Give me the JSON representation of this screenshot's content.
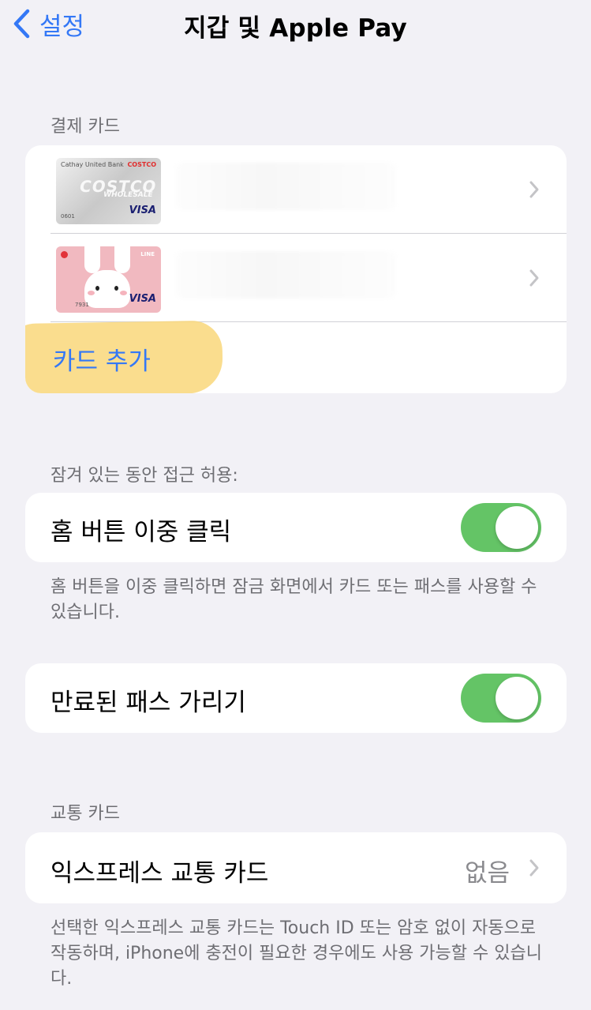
{
  "nav": {
    "back_label": "설정",
    "title": "지갑 및 Apple Pay"
  },
  "payment_cards": {
    "header": "결제 카드",
    "cards": [
      {
        "bank_text": "Cathay United Bank",
        "brand_text": "COSTCO",
        "wordmark": "COSTCO",
        "sub": "WHOLESALE",
        "network": "VISA",
        "last4": "0601"
      },
      {
        "brand_text": "LINE",
        "network": "VISA",
        "last4": "7931"
      }
    ],
    "add_label": "카드 추가"
  },
  "locked_access": {
    "header": "잠겨 있는 동안 접근 허용:",
    "double_click": {
      "label": "홈 버튼 이중 클릭",
      "on": true
    },
    "footer": "홈 버튼을 이중 클릭하면 잠금 화면에서 카드 또는 패스를 사용할 수 있습니다."
  },
  "hide_expired": {
    "label": "만료된 패스 가리기",
    "on": true
  },
  "transit": {
    "header": "교통 카드",
    "express": {
      "label": "익스프레스 교통 카드",
      "value": "없음"
    },
    "footer": "선택한 익스프레스 교통 카드는 Touch ID 또는 암호 없이 자동으로 작동하며, iPhone에 충전이 필요한 경우에도 사용 가능할 수 있습니다."
  },
  "colors": {
    "accent": "#3478f6",
    "switch_on": "#64c466",
    "highlight": "#f9d77a",
    "background": "#f2f1f6"
  }
}
